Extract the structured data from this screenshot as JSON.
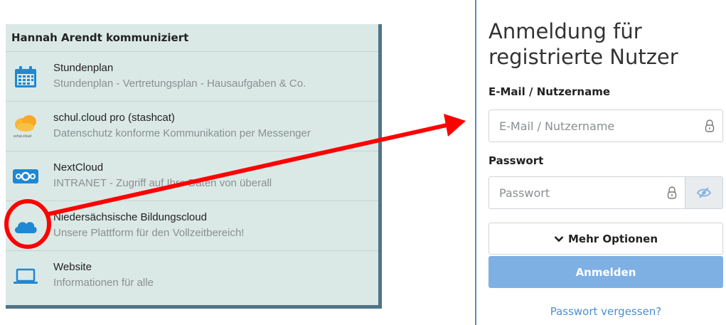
{
  "left": {
    "title": "Hannah Arendt kommuniziert",
    "items": [
      {
        "title": "Stundenplan",
        "subtitle": "Stundenplan - Vertretungsplan - Hausaufgaben & Co.",
        "icon": "calendar-icon"
      },
      {
        "title": "schul.cloud pro (stashcat)",
        "subtitle": "Datenschutz konforme Kommunikation per Messenger",
        "icon": "schul-cloud-logo-icon",
        "logo_text": "schul.cloud"
      },
      {
        "title": "NextCloud",
        "subtitle": "INTRANET - Zugriff auf Ihre Daten von überall",
        "icon": "nextcloud-icon"
      },
      {
        "title": "Niedersächsische Bildungscloud",
        "subtitle": "Unsere Plattform für den Vollzeitbereich!",
        "icon": "cloud-icon"
      },
      {
        "title": "Website",
        "subtitle": "Informationen für alle",
        "icon": "laptop-icon"
      }
    ]
  },
  "login": {
    "title": "Anmeldung für registrierte Nutzer",
    "email_label": "E-Mail / Nutzername",
    "email_placeholder": "E-Mail / Nutzername",
    "password_label": "Passwort",
    "password_placeholder": "Passwort",
    "more_options": "Mehr Optionen",
    "submit": "Anmelden",
    "forgot": "Passwort vergessen?"
  },
  "colors": {
    "panel_bg": "#dbe9e6",
    "panel_border": "#4f7486",
    "icon_blue": "#1e88d4",
    "login_button": "#7fb0e4",
    "annotation": "#ff0000"
  }
}
